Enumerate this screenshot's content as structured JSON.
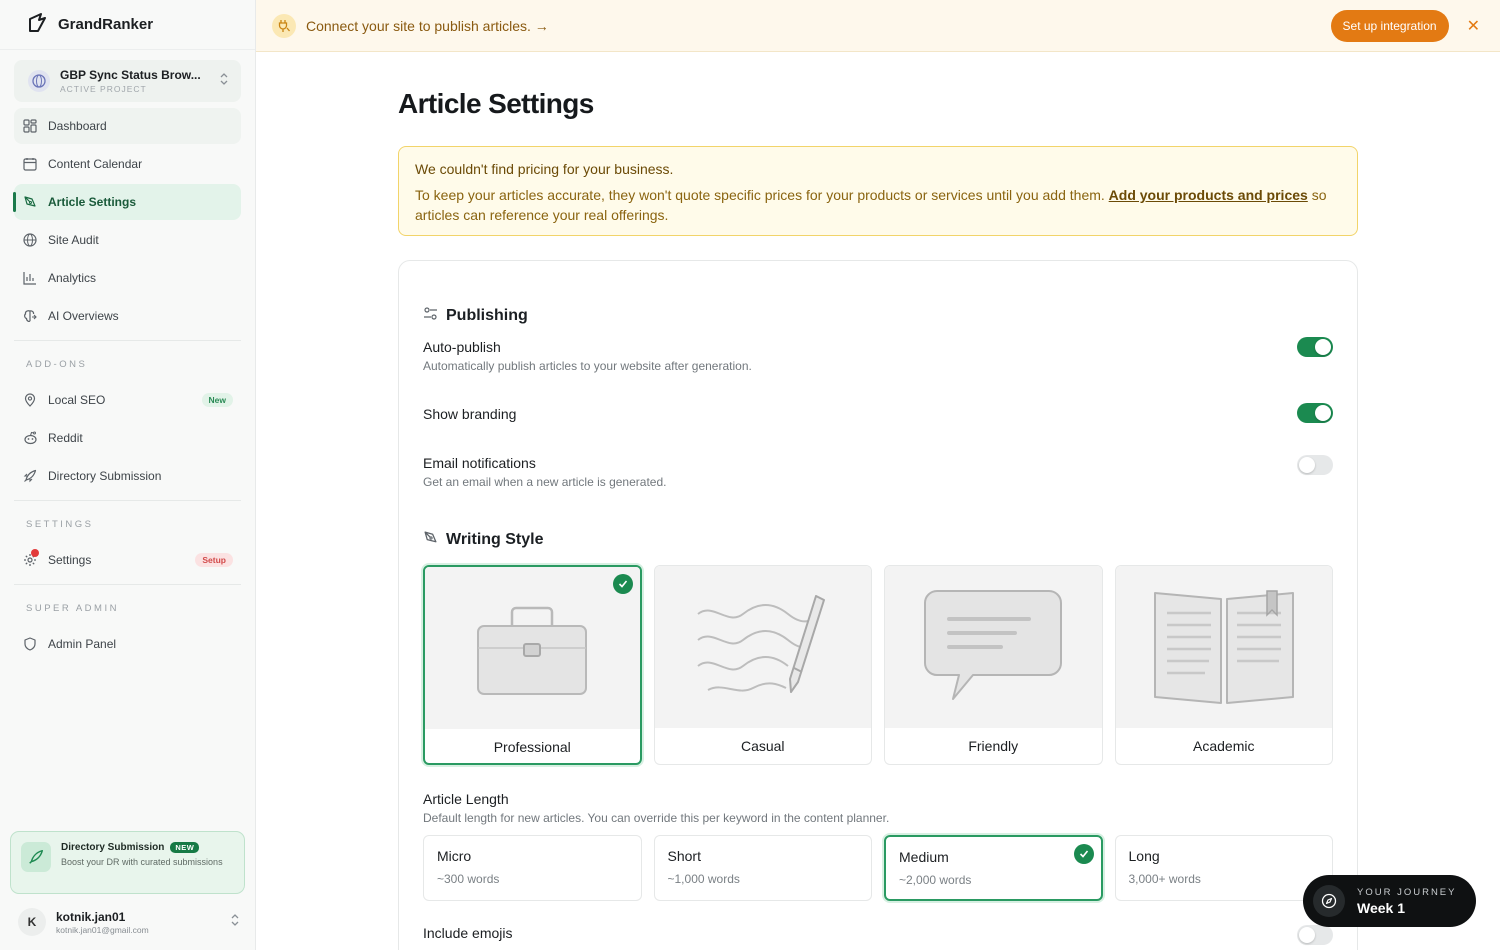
{
  "brand": {
    "name": "GrandRanker"
  },
  "project": {
    "name": "GBP Sync Status Brow...",
    "subtitle": "ACTIVE PROJECT"
  },
  "nav": {
    "dashboard": "Dashboard",
    "calendar": "Content Calendar",
    "article_settings": "Article Settings",
    "site_audit": "Site Audit",
    "analytics": "Analytics",
    "ai_overviews": "AI Overviews"
  },
  "addons": {
    "label": "ADD-ONS",
    "local_seo": "Local SEO",
    "local_seo_badge": "New",
    "reddit": "Reddit",
    "directory": "Directory Submission"
  },
  "settings_section": {
    "label": "SETTINGS",
    "settings": "Settings",
    "settings_badge": "Setup"
  },
  "super_admin": {
    "label": "SUPER ADMIN",
    "admin_panel": "Admin Panel"
  },
  "promo": {
    "title": "Directory Submission",
    "badge": "NEW",
    "desc": "Boost your DR with curated submissions"
  },
  "user": {
    "initial": "K",
    "name": "kotnik.jan01",
    "email": "kotnik.jan01@gmail.com"
  },
  "banner": {
    "text": "Connect your site to publish articles. →",
    "button": "Set up integration",
    "close": "✕"
  },
  "page": {
    "title": "Article Settings"
  },
  "warning": {
    "title": "We couldn't find pricing for your business.",
    "body_before": "To keep your articles accurate, they won't quote specific prices for your products or services until you add them. ",
    "link": "Add your products and prices",
    "body_after": " so articles can reference your real offerings."
  },
  "publishing": {
    "heading": "Publishing",
    "auto_publish": {
      "title": "Auto-publish",
      "desc": "Automatically publish articles to your website after generation.",
      "on": true
    },
    "branding": {
      "title": "Show branding",
      "on": true
    },
    "email": {
      "title": "Email notifications",
      "desc": "Get an email when a new article is generated.",
      "on": false
    }
  },
  "writing": {
    "heading": "Writing Style",
    "styles": [
      {
        "label": "Professional",
        "selected": true
      },
      {
        "label": "Casual",
        "selected": false
      },
      {
        "label": "Friendly",
        "selected": false
      },
      {
        "label": "Academic",
        "selected": false
      }
    ]
  },
  "length": {
    "title": "Article Length",
    "desc": "Default length for new articles. You can override this per keyword in the content planner.",
    "options": [
      {
        "title": "Micro",
        "sub": "~300 words",
        "selected": false
      },
      {
        "title": "Short",
        "sub": "~1,000 words",
        "selected": false
      },
      {
        "title": "Medium",
        "sub": "~2,000 words",
        "selected": true
      },
      {
        "title": "Long",
        "sub": "3,000+ words",
        "selected": false
      }
    ]
  },
  "emojis": {
    "title": "Include emojis",
    "on": false
  },
  "journey": {
    "subtitle": "YOUR JOURNEY",
    "title": "Week 1"
  },
  "colors": {
    "accent": "#1b8a50",
    "banner_button": "#e37a13",
    "warning_border": "#f2d46a"
  }
}
